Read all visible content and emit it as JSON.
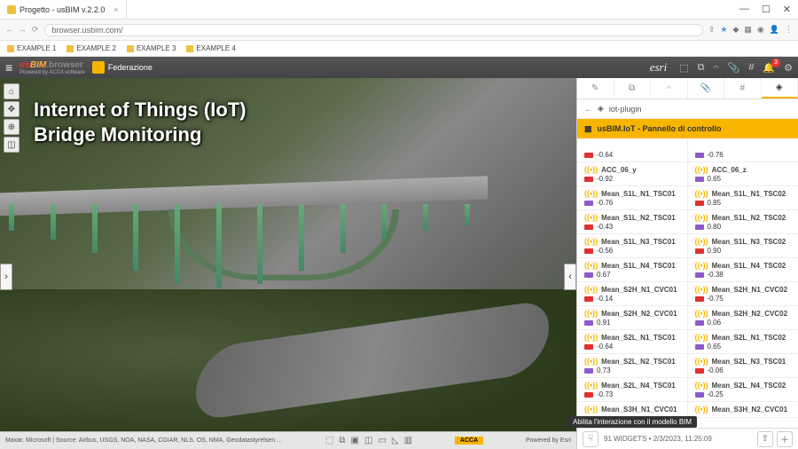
{
  "browser": {
    "tab_title": "Progetto - usBIM v.2.2.0",
    "url": "browser.usbim.com/",
    "bookmarks": [
      "EXAMPLE 1",
      "EXAMPLE 2",
      "EXAMPLE 3",
      "EXAMPLE 4"
    ]
  },
  "app": {
    "logo_parts": {
      "us": "us",
      "bim": "BIM",
      "suffix": ".browser"
    },
    "powered": "Powered by ACCA software",
    "federation": "Federazione",
    "esri": "esri",
    "notification_count": "3"
  },
  "viewport": {
    "title_line1": "Internet of Things (IoT)",
    "title_line2": "Bridge Monitoring",
    "attribution": "Maxar, Microsoft | Source: Airbus, USGS, NOA, NASA, CGIAR, NLS, OS, NMA, Geodatastyrelsen …",
    "powered_right": "Powered by Esri",
    "acca": "ACCA"
  },
  "panel": {
    "breadcrumb": "iot-plugin",
    "header": "usBIM.IoT - Pannello di controllo",
    "footer_status": "91 WIDGETS • 2/3/2023, 11:25:09",
    "tooltip": "Abilita l'interazione con il modello BIM"
  },
  "sensors": [
    {
      "left": {
        "name": "",
        "value": "-0.64",
        "color": "#e03030",
        "partial": true
      },
      "right": {
        "name": "",
        "value": "-0.76",
        "color": "#8a5cc9",
        "partial": true
      }
    },
    {
      "left": {
        "name": "ACC_06_y",
        "value": "-0.92",
        "color": "#e03030"
      },
      "right": {
        "name": "ACC_06_z",
        "value": "0.65",
        "color": "#8a5cc9"
      }
    },
    {
      "left": {
        "name": "Mean_S1L_N1_TSC01",
        "value": "-0.76",
        "color": "#8a5cc9"
      },
      "right": {
        "name": "Mean_S1L_N1_TSC02",
        "value": "0.85",
        "color": "#e03030"
      }
    },
    {
      "left": {
        "name": "Mean_S1L_N2_TSC01",
        "value": "-0.43",
        "color": "#e03030"
      },
      "right": {
        "name": "Mean_S1L_N2_TSC02",
        "value": "0.80",
        "color": "#8a5cc9"
      }
    },
    {
      "left": {
        "name": "Mean_S1L_N3_TSC01",
        "value": "-0.56",
        "color": "#e03030"
      },
      "right": {
        "name": "Mean_S1L_N3_TSC02",
        "value": "0.90",
        "color": "#e03030"
      }
    },
    {
      "left": {
        "name": "Mean_S1L_N4_TSC01",
        "value": "0.67",
        "color": "#8a5cc9"
      },
      "right": {
        "name": "Mean_S1L_N4_TSC02",
        "value": "-0.38",
        "color": "#8a5cc9"
      }
    },
    {
      "left": {
        "name": "Mean_S2H_N1_CVC01",
        "value": "-0.14",
        "color": "#e03030"
      },
      "right": {
        "name": "Mean_S2H_N1_CVC02",
        "value": "-0.75",
        "color": "#e03030"
      }
    },
    {
      "left": {
        "name": "Mean_S2H_N2_CVC01",
        "value": "0.91",
        "color": "#8a5cc9"
      },
      "right": {
        "name": "Mean_S2H_N2_CVC02",
        "value": "0.06",
        "color": "#8a5cc9"
      }
    },
    {
      "left": {
        "name": "Mean_S2L_N1_TSC01",
        "value": "-0.64",
        "color": "#e03030"
      },
      "right": {
        "name": "Mean_S2L_N1_TSC02",
        "value": "0.65",
        "color": "#8a5cc9"
      }
    },
    {
      "left": {
        "name": "Mean_S2L_N2_TSC01",
        "value": "0.73",
        "color": "#8a5cc9"
      },
      "right": {
        "name": "Mean_S2L_N3_TSC01",
        "value": "-0.06",
        "color": "#e03030"
      }
    },
    {
      "left": {
        "name": "Mean_S2L_N4_TSC01",
        "value": "-0.73",
        "color": "#e03030"
      },
      "right": {
        "name": "Mean_S2L_N4_TSC02",
        "value": "-0.25",
        "color": "#8a5cc9"
      }
    },
    {
      "left": {
        "name": "Mean_S3H_N1_CVC01",
        "value": "",
        "color": ""
      },
      "right": {
        "name": "Mean_S3H_N2_CVC01",
        "value": "",
        "color": ""
      }
    }
  ],
  "colors": {
    "accent": "#f7b500",
    "red": "#e03030",
    "purple": "#8a5cc9"
  }
}
